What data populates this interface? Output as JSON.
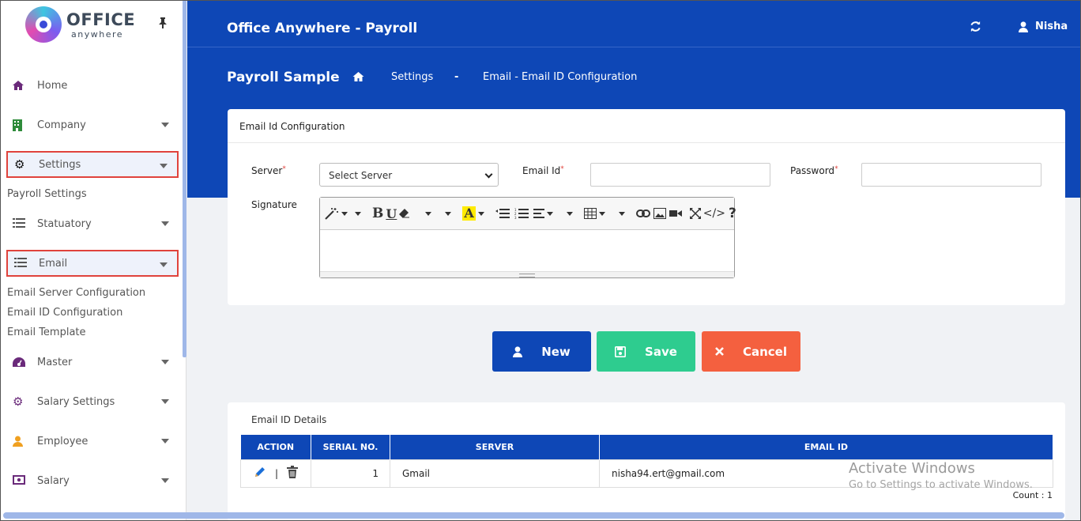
{
  "sidebar": {
    "logo_word": "OFFICE",
    "logo_sub": "anywhere",
    "items": [
      {
        "label": "Home",
        "icon": "home-icon"
      },
      {
        "label": "Company",
        "icon": "building-icon"
      },
      {
        "label": "Settings",
        "icon": "gear-icon"
      },
      {
        "label": "Statuatory",
        "icon": "list-icon"
      },
      {
        "label": "Email",
        "icon": "list-icon"
      },
      {
        "label": "Master",
        "icon": "dashboard-icon"
      },
      {
        "label": "Salary Settings",
        "icon": "gear-icon"
      },
      {
        "label": "Employee",
        "icon": "person-icon"
      },
      {
        "label": "Salary",
        "icon": "money-icon"
      }
    ],
    "settings_sub": [
      "Payroll Settings"
    ],
    "email_sub": [
      "Email Server Configuration",
      "Email ID Configuration",
      "Email Template"
    ]
  },
  "header": {
    "app_title": "Office Anywhere - Payroll",
    "user_name": "Nisha"
  },
  "breadcrumb": {
    "page_title": "Payroll Sample",
    "settings": "Settings",
    "separator": "-",
    "current": "Email - Email ID Configuration"
  },
  "form": {
    "card_title": "Email Id Configuration",
    "server_label": "Server",
    "server_value": "Select Server",
    "email_label": "Email Id",
    "password_label": "Password",
    "signature_label": "Signature",
    "required_mark": "*"
  },
  "buttons": {
    "new": "New",
    "save": "Save",
    "cancel": "Cancel"
  },
  "details": {
    "title": "Email ID Details",
    "columns": [
      "ACTION",
      "SERIAL NO.",
      "SERVER",
      "EMAIL ID"
    ],
    "rows": [
      {
        "serial": "1",
        "server": "Gmail",
        "email": "nisha94.ert@gmail.com",
        "sep": "|"
      }
    ],
    "count": "Count : 1"
  },
  "watermark": {
    "line1": "Activate Windows",
    "line2": "Go to Settings to activate Windows."
  },
  "colors": {
    "primary": "#0e47b6",
    "save": "#2ecc8f",
    "cancel": "#f4603f",
    "highlight_box": "#e0433c"
  }
}
